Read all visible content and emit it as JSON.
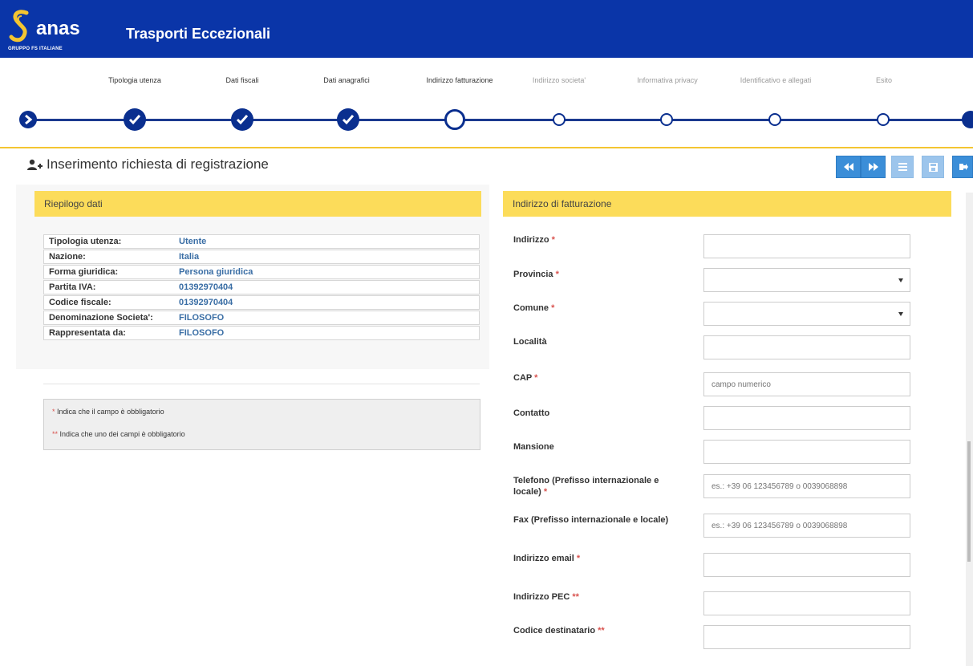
{
  "header": {
    "logo_text": "anas",
    "logo_sub": "GRUPPO FS ITALIANE",
    "title": "Trasporti Eccezionali",
    "brand_color": "#0a35a8"
  },
  "stepper": {
    "steps": [
      {
        "label": "Tipologia utenza",
        "state": "done"
      },
      {
        "label": "Dati fiscali",
        "state": "done"
      },
      {
        "label": "Dati anagrafici",
        "state": "done"
      },
      {
        "label": "Indirizzo fatturazione",
        "state": "current"
      },
      {
        "label": "Indirizzo societa'",
        "state": "future"
      },
      {
        "label": "Informativa privacy",
        "state": "future"
      },
      {
        "label": "Identificativo e allegati",
        "state": "future"
      },
      {
        "label": "Esito",
        "state": "future"
      }
    ]
  },
  "page": {
    "title": "Inserimento richiesta di registrazione",
    "toolbar": [
      "prev-icon",
      "next-icon",
      "list-icon",
      "save-icon",
      "exit-icon"
    ]
  },
  "summary": {
    "header": "Riepilogo dati",
    "rows": [
      {
        "label": "Tipologia utenza:",
        "value": "Utente"
      },
      {
        "label": "Nazione:",
        "value": "Italia"
      },
      {
        "label": "Forma giuridica:",
        "value": "Persona giuridica"
      },
      {
        "label": "Partita IVA:",
        "value": "01392970404"
      },
      {
        "label": "Codice fiscale:",
        "value": "01392970404"
      },
      {
        "label": "Denominazione Societa':",
        "value": "FILOSOFO"
      },
      {
        "label": "Rappresentata da:",
        "value": "FILOSOFO"
      }
    ]
  },
  "legend": {
    "line1_mark": "*",
    "line1_text": " Indica che il campo è obbligatorio",
    "line2_mark": "**",
    "line2_text": " Indica che uno dei campi è obbligatorio"
  },
  "form": {
    "header": "Indirizzo di fatturazione",
    "fields": {
      "indirizzo": {
        "label": "Indirizzo",
        "req": "*",
        "value": ""
      },
      "provincia": {
        "label": "Provincia",
        "req": "*",
        "value": ""
      },
      "comune": {
        "label": "Comune",
        "req": "*",
        "value": ""
      },
      "localita": {
        "label": "Località",
        "req": "",
        "value": ""
      },
      "cap": {
        "label": "CAP",
        "req": "*",
        "placeholder": "campo numerico"
      },
      "contatto": {
        "label": "Contatto",
        "req": "",
        "value": ""
      },
      "mansione": {
        "label": "Mansione",
        "req": "",
        "value": ""
      },
      "telefono": {
        "label": "Telefono (Prefisso internazionale e locale)",
        "req": "*",
        "placeholder": "es.: +39 06 123456789 o 0039068898"
      },
      "fax": {
        "label": "Fax (Prefisso internazionale e locale)",
        "req": "",
        "placeholder": "es.: +39 06 123456789 o 0039068898"
      },
      "email": {
        "label": "Indirizzo email",
        "req": "*",
        "value": ""
      },
      "pec": {
        "label": "Indirizzo PEC",
        "req": "**",
        "value": ""
      },
      "codice": {
        "label": "Codice destinatario",
        "req": "**",
        "value": ""
      }
    }
  },
  "colors": {
    "accent_yellow": "#fcdc5a",
    "required_red": "#d9534f",
    "value_blue": "#3a6ea5",
    "button_blue": "#3b8ed8"
  }
}
